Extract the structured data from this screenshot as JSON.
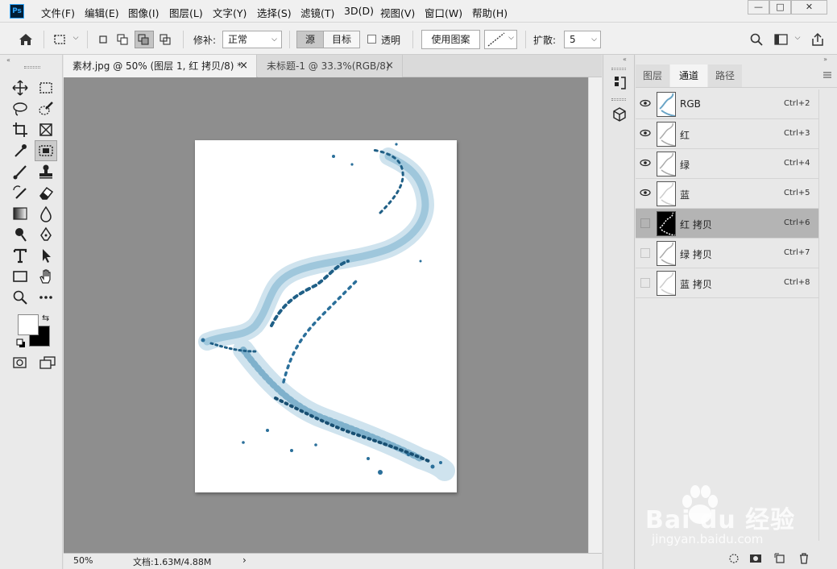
{
  "app": {
    "logo": "Ps"
  },
  "menu": [
    "文件(F)",
    "编辑(E)",
    "图像(I)",
    "图层(L)",
    "文字(Y)",
    "选择(S)",
    "滤镜(T)",
    "3D(D)",
    "视图(V)",
    "窗口(W)",
    "帮助(H)"
  ],
  "window_controls": {
    "minimize": "—",
    "maximize": "□",
    "close": "✕"
  },
  "options_bar": {
    "patch_label": "修补:",
    "patch_mode": "正常",
    "source_label": "源",
    "target_label": "目标",
    "transparent_label": "透明",
    "use_pattern_label": "使用图案",
    "diffusion_label": "扩散:",
    "diffusion_value": "5"
  },
  "tabs": [
    {
      "label": "素材.jpg @ 50% (图层 1, 红 拷贝/8) *",
      "active": true
    },
    {
      "label": "未标题-1 @ 33.3%(RGB/8)",
      "active": false
    }
  ],
  "tab_close": "×",
  "status": {
    "zoom": "50%",
    "doc_info": "文档:1.63M/4.88M",
    "arrow": "›"
  },
  "panel_tabs": [
    "图层",
    "通道",
    "路径"
  ],
  "active_panel_tab": "通道",
  "channels": [
    {
      "name": "RGB",
      "shortcut": "Ctrl+2",
      "visible": true,
      "selected": false
    },
    {
      "name": "红",
      "shortcut": "Ctrl+3",
      "visible": true,
      "selected": false
    },
    {
      "name": "绿",
      "shortcut": "Ctrl+4",
      "visible": true,
      "selected": false
    },
    {
      "name": "蓝",
      "shortcut": "Ctrl+5",
      "visible": true,
      "selected": false
    },
    {
      "name": "红 拷贝",
      "shortcut": "Ctrl+6",
      "visible": false,
      "selected": true
    },
    {
      "name": "绿 拷贝",
      "shortcut": "Ctrl+7",
      "visible": false,
      "selected": false
    },
    {
      "name": "蓝 拷贝",
      "shortcut": "Ctrl+8",
      "visible": false,
      "selected": false
    }
  ],
  "watermark": {
    "brand": "Bai du 经验",
    "url": "jingyan.baidu.com"
  },
  "colors": {
    "accent_selected_row": "#b4b4b4",
    "canvas_bg": "#8e8e8e",
    "water": "#2a6f9a"
  }
}
